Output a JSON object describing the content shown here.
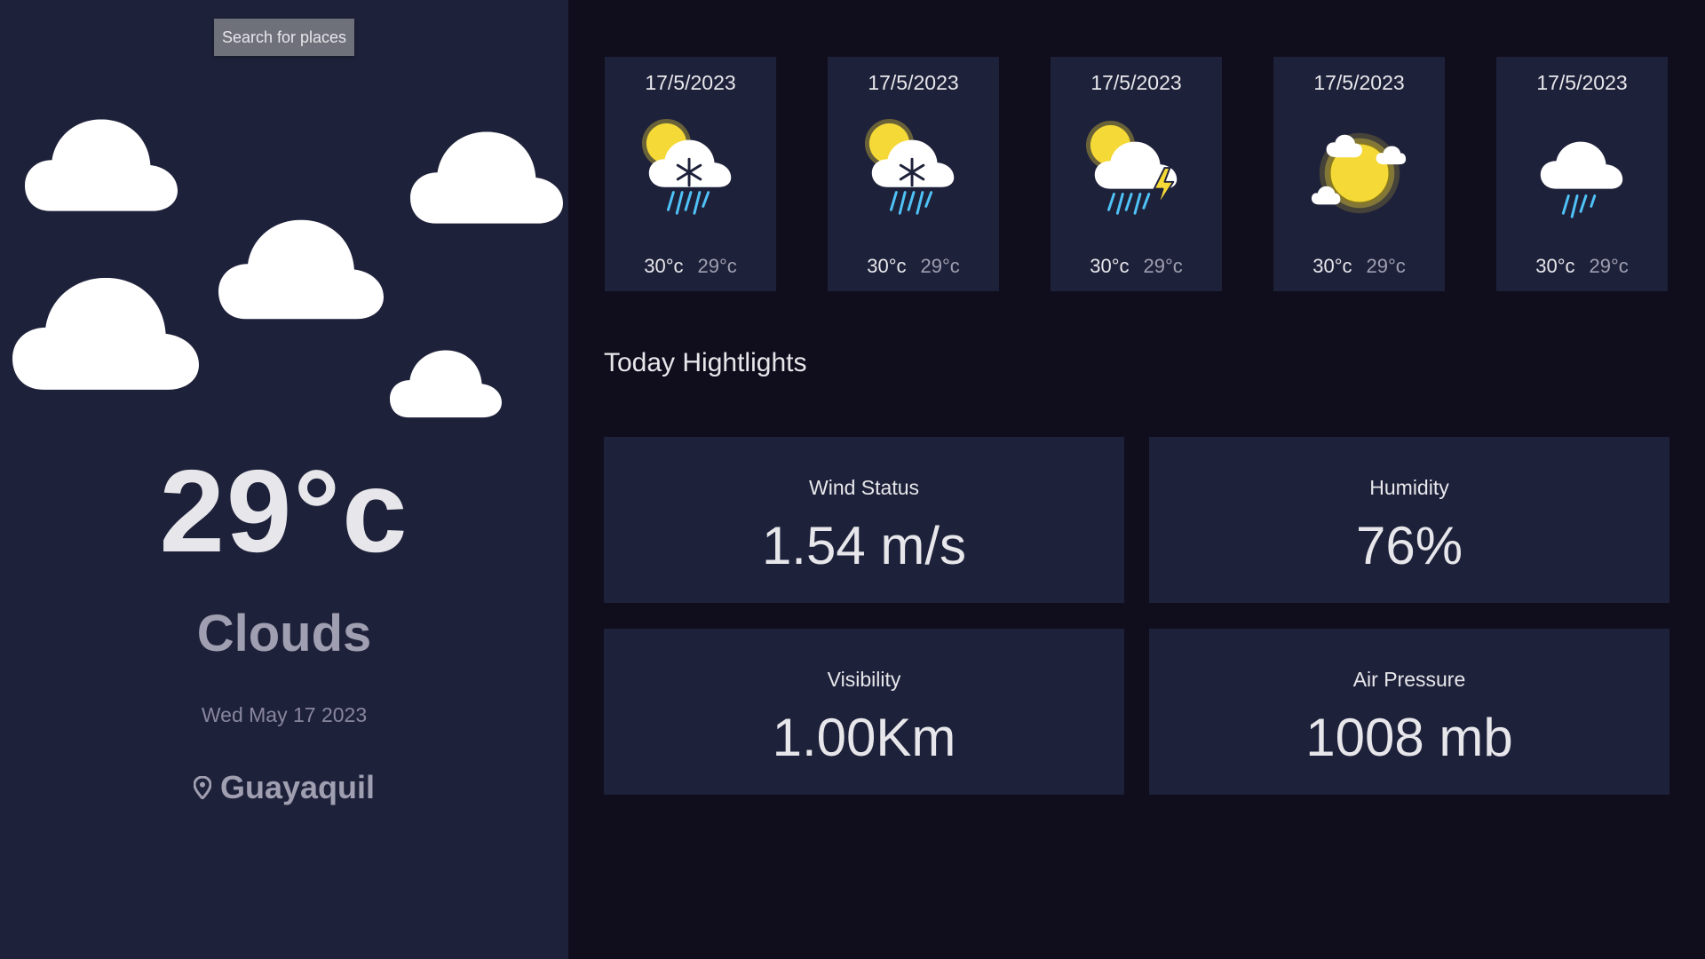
{
  "sidebar": {
    "search_label": "Search for places",
    "temperature": "29°c",
    "condition": "Clouds",
    "date": "Wed May 17 2023",
    "location": "Guayaquil",
    "location_icon": "map-pin-icon"
  },
  "forecast": [
    {
      "date": "17/5/2023",
      "icon": "sun-cloud-snow-icon",
      "max": "30°c",
      "min": "29°c"
    },
    {
      "date": "17/5/2023",
      "icon": "sun-cloud-snow-icon",
      "max": "30°c",
      "min": "29°c"
    },
    {
      "date": "17/5/2023",
      "icon": "sun-cloud-thunderstorm-icon",
      "max": "30°c",
      "min": "29°c"
    },
    {
      "date": "17/5/2023",
      "icon": "sun-with-clouds-icon",
      "max": "30°c",
      "min": "29°c"
    },
    {
      "date": "17/5/2023",
      "icon": "cloud-rain-icon",
      "max": "30°c",
      "min": "29°c"
    }
  ],
  "highlights": {
    "title": "Today Hightlights",
    "wind": {
      "label": "Wind Status",
      "value": "1.54 m/s"
    },
    "humidity": {
      "label": "Humidity",
      "value": "76%"
    },
    "visibility": {
      "label": "Visibility",
      "value": "1.00Km"
    },
    "pressure": {
      "label": "Air Pressure",
      "value": "1008 mb"
    }
  },
  "colors": {
    "background": "#100e1d",
    "panel": "#1e213a",
    "text_primary": "#e7e7eb",
    "text_secondary": "#a09fb1",
    "search_button": "#6e707a",
    "sun": "#f5d936",
    "rain": "#4fc3f7"
  }
}
